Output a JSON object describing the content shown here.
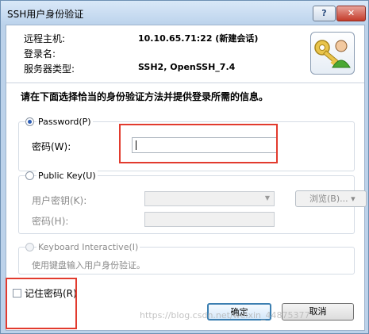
{
  "window": {
    "title": "SSH用户身份验证",
    "help_label": "?",
    "close_label": "✕"
  },
  "info": {
    "remote_host_label": "远程主机:",
    "remote_host_value": "10.10.65.71:22 (新建会话)",
    "login_label": "登录名:",
    "server_type_label": "服务器类型:",
    "server_type_value": "SSH2, OpenSSH_7.4"
  },
  "instruction": "请在下面选择恰当的身份验证方法并提供登录所需的信息。",
  "password_group": {
    "label": "Password(P)",
    "selected": true,
    "field_label": "密码(W):",
    "value": ""
  },
  "pubkey_group": {
    "label": "Public Key(U)",
    "selected": false,
    "user_key_label": "用户密钥(K):",
    "browse_label": "浏览(B)... ▾",
    "passphrase_label": "密码(H):"
  },
  "keyboard_group": {
    "label": "Keyboard Interactive(I)",
    "selected": false,
    "description": "使用键盘输入用户身份验证。"
  },
  "remember": {
    "label": "记住密码(R)",
    "checked": false
  },
  "buttons": {
    "ok": "确定",
    "cancel": "取消"
  },
  "watermark": "https://blog.csdn.net/weixin_44875377",
  "colors": {
    "accent": "#2c5db5",
    "highlight": "#e23b2e",
    "title_bar": "#bcd3ec"
  },
  "icons": {
    "logo": "key-user-icon"
  }
}
